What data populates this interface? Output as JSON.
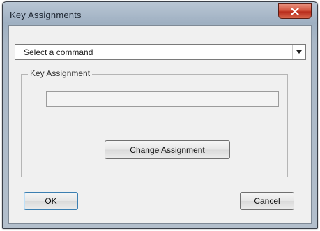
{
  "window": {
    "title": "Key Assignments"
  },
  "command_select": {
    "value": "Select a command"
  },
  "key_assignment_group": {
    "label": "Key Assignment",
    "field_value": ""
  },
  "buttons": {
    "change_assignment": "Change Assignment",
    "ok": "OK",
    "cancel": "Cancel"
  },
  "icons": {
    "close": "close-icon",
    "dropdown": "chevron-down-icon"
  },
  "colors": {
    "close_button": "#c94a35",
    "titlebar": "#a9b9ca",
    "dialog_background": "#f0f0f0"
  }
}
